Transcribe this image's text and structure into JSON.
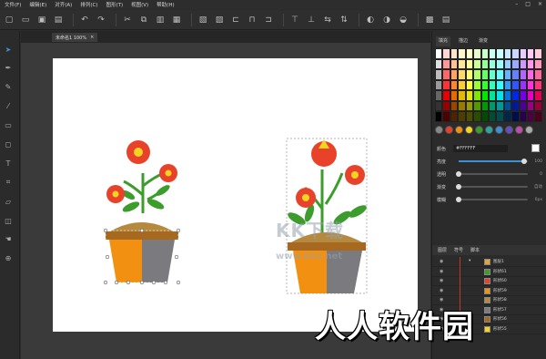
{
  "menubar": {
    "items": [
      "文件(F)",
      "编辑(E)",
      "对齐(A)",
      "排列(C)",
      "图形(T)",
      "视图(V)",
      "帮助(H)"
    ]
  },
  "document": {
    "tab_label": "未命名1 100%",
    "close_glyph": "×"
  },
  "panel": {
    "tabs": [
      "填充",
      "描边",
      "渐变"
    ],
    "color_label": "颜色",
    "color_value": "#FFFFFF",
    "props": [
      {
        "label": "亮度",
        "value": "100",
        "fill": 0.95
      },
      {
        "label": "透明",
        "value": "0",
        "fill": 0.0
      },
      {
        "label": "渐变",
        "value": "自动",
        "fill": 0.0
      },
      {
        "label": "模糊",
        "value": "0px",
        "fill": 0.0
      }
    ]
  },
  "layers": {
    "tabs": [
      "图层",
      "符号",
      "脚本"
    ],
    "group_name": "图层1",
    "items": [
      "形状61",
      "形状60",
      "形状59",
      "形状58",
      "形状57",
      "形状56",
      "形状55"
    ]
  },
  "watermarks": {
    "kk": "KK下载",
    "site": "www.kkx.net",
    "brand": "人人软件园"
  },
  "swatch_colors": [
    [
      "#ffffff",
      "#ffd5d5",
      "#ffe3cc",
      "#fff5cc",
      "#ffffcc",
      "#e6ffcc",
      "#ccffcc",
      "#ccfff0",
      "#ccffff",
      "#cce6ff",
      "#ccd5ff",
      "#e6ccff",
      "#ffccf5",
      "#ffccdd"
    ],
    [
      "#e0e0e0",
      "#ff9999",
      "#ffc299",
      "#ffe699",
      "#ffff99",
      "#ccff99",
      "#99ff99",
      "#99ffdd",
      "#99ffff",
      "#99ccff",
      "#99aaff",
      "#cc99ff",
      "#ff99ee",
      "#ff99bb"
    ],
    [
      "#bdbdbd",
      "#ff6666",
      "#ffa366",
      "#ffd966",
      "#ffff66",
      "#b3ff66",
      "#66ff66",
      "#66ffcc",
      "#66ffff",
      "#66b3ff",
      "#6680ff",
      "#b366ff",
      "#ff66e6",
      "#ff6699"
    ],
    [
      "#999999",
      "#ff3333",
      "#ff8533",
      "#ffcc33",
      "#ffff33",
      "#99ff33",
      "#33ff33",
      "#33ffbb",
      "#33ffff",
      "#3399ff",
      "#3355ff",
      "#9933ff",
      "#ff33dd",
      "#ff3377"
    ],
    [
      "#666666",
      "#e60000",
      "#e66a00",
      "#e6b800",
      "#e6e600",
      "#80e600",
      "#00e600",
      "#00e699",
      "#00e6e6",
      "#0073e6",
      "#0026e6",
      "#7300e6",
      "#e600c4",
      "#e60055"
    ],
    [
      "#333333",
      "#990000",
      "#994700",
      "#997a00",
      "#999900",
      "#559900",
      "#009900",
      "#009966",
      "#009999",
      "#004d99",
      "#001a99",
      "#4d0099",
      "#990082",
      "#990038"
    ],
    [
      "#000000",
      "#4d0000",
      "#4d2400",
      "#4d3d00",
      "#4d4d00",
      "#2b4d00",
      "#004d00",
      "#004d33",
      "#004d4d",
      "#00264d",
      "#000d4d",
      "#26004d",
      "#4d0041",
      "#4d001c"
    ]
  ]
}
